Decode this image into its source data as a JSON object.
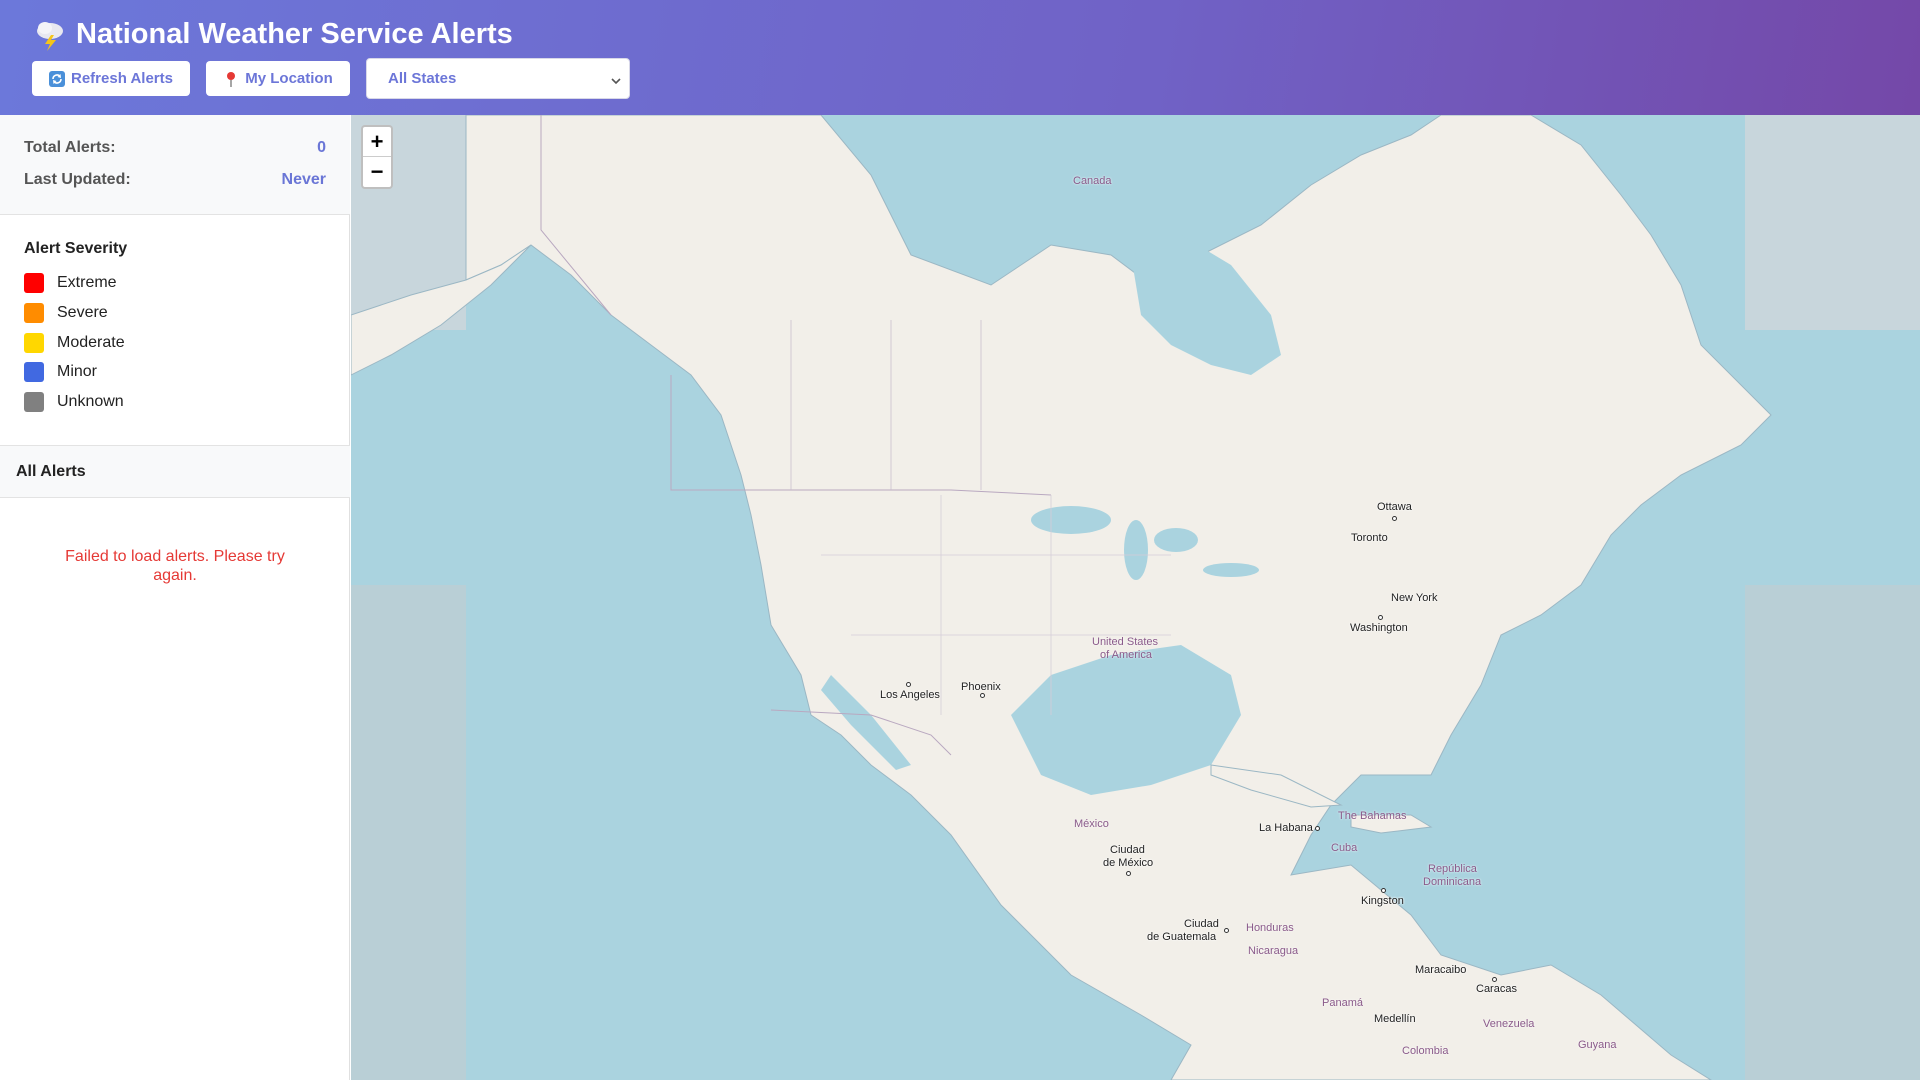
{
  "header": {
    "title": "National Weather Service Alerts",
    "refresh_label": "Refresh Alerts",
    "location_label": "My Location",
    "state_select": {
      "selected": "All States"
    }
  },
  "stats": {
    "total_label": "Total Alerts:",
    "total_value": "0",
    "updated_label": "Last Updated:",
    "updated_value": "Never"
  },
  "legend": {
    "title": "Alert Severity",
    "items": [
      {
        "label": "Extreme",
        "color": "#ff0000"
      },
      {
        "label": "Severe",
        "color": "#ff8c00"
      },
      {
        "label": "Moderate",
        "color": "#ffd700"
      },
      {
        "label": "Minor",
        "color": "#4169e1"
      },
      {
        "label": "Unknown",
        "color": "#808080"
      }
    ]
  },
  "alerts": {
    "title": "All Alerts",
    "error": "Failed to load alerts. Please try again."
  },
  "map": {
    "zoom_in": "+",
    "zoom_out": "−",
    "labels": {
      "canada": "Canada",
      "usa_line1": "United States",
      "usa_line2": "of America",
      "mexico": "México",
      "bahamas": "The Bahamas",
      "cuba": "Cuba",
      "dominicana_line1": "República",
      "dominicana_line2": "Dominicana",
      "honduras": "Honduras",
      "nicaragua": "Nicaragua",
      "panama": "Panamá",
      "venezuela": "Venezuela",
      "colombia": "Colombia",
      "guyana": "Guyana"
    },
    "cities": {
      "ottawa": "Ottawa",
      "toronto": "Toronto",
      "new_york": "New York",
      "washington": "Washington",
      "los_angeles": "Los Angeles",
      "phoenix": "Phoenix",
      "la_habana": "La Habana",
      "ciudad_mexico_line1": "Ciudad",
      "ciudad_mexico_line2": "de México",
      "kingston": "Kingston",
      "guatemala_line1": "Ciudad",
      "guatemala_line2": "de Guatemala",
      "maracaibo": "Maracaibo",
      "caracas": "Caracas",
      "medellin": "Medellín"
    },
    "colors": {
      "water": "#aad3df",
      "land": "#f2efe9",
      "border": "#b9a8c0"
    }
  }
}
